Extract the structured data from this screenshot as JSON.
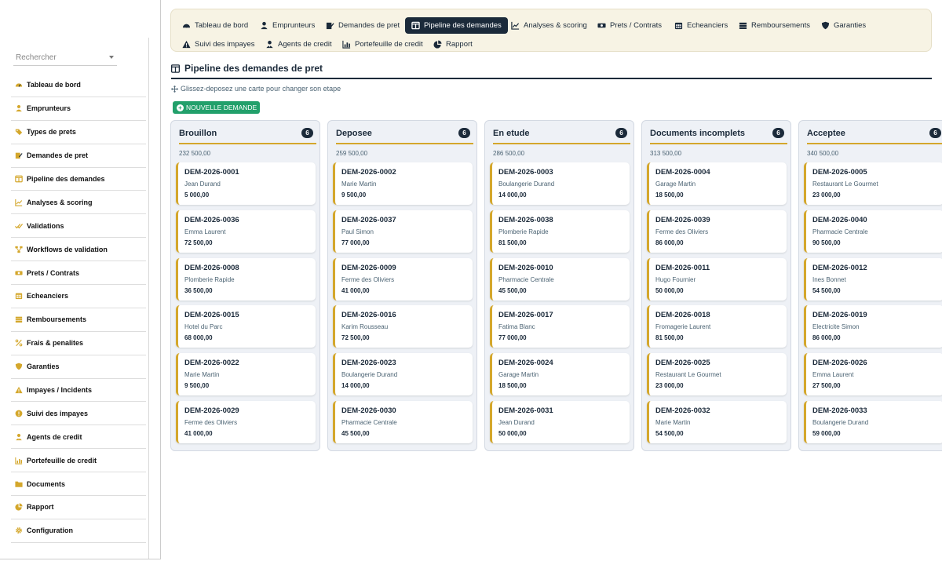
{
  "sidebar": {
    "select_placeholder": "Rechercher",
    "items": [
      {
        "label": "Tableau de bord",
        "icon": "gauge-icon"
      },
      {
        "label": "Emprunteurs",
        "icon": "user-icon"
      },
      {
        "label": "Types de prets",
        "icon": "tags-icon"
      },
      {
        "label": "Demandes de pret",
        "icon": "edit-document-icon"
      },
      {
        "label": "Pipeline des demandes",
        "icon": "columns-icon"
      },
      {
        "label": "Analyses & scoring",
        "icon": "line-chart-icon"
      },
      {
        "label": "Validations",
        "icon": "double-check-icon"
      },
      {
        "label": "Workflows de validation",
        "icon": "workflow-icon"
      },
      {
        "label": "Prets / Contrats",
        "icon": "money-icon"
      },
      {
        "label": "Echeanciers",
        "icon": "calendar-icon"
      },
      {
        "label": "Remboursements",
        "icon": "money-stack-icon"
      },
      {
        "label": "Frais & penalites",
        "icon": "percent-icon"
      },
      {
        "label": "Garanties",
        "icon": "shield-icon"
      },
      {
        "label": "Impayes / Incidents",
        "icon": "warning-icon"
      },
      {
        "label": "Suivi des impayes",
        "icon": "exclamation-circle-icon"
      },
      {
        "label": "Agents de credit",
        "icon": "user-tie-icon"
      },
      {
        "label": "Portefeuille de credit",
        "icon": "bar-chart-icon"
      },
      {
        "label": "Documents",
        "icon": "folder-icon"
      },
      {
        "label": "Rapport",
        "icon": "pie-chart-icon"
      },
      {
        "label": "Configuration",
        "icon": "gear-icon"
      }
    ]
  },
  "topnav": {
    "tabs": [
      {
        "label": "Tableau de bord",
        "icon": "gauge-icon",
        "active": false
      },
      {
        "label": "Emprunteurs",
        "icon": "user-icon",
        "active": false
      },
      {
        "label": "Demandes de pret",
        "icon": "edit-document-icon",
        "active": false
      },
      {
        "label": "Pipeline des demandes",
        "icon": "columns-icon",
        "active": true
      },
      {
        "label": "Analyses & scoring",
        "icon": "line-chart-icon",
        "active": false
      },
      {
        "label": "Prets / Contrats",
        "icon": "money-icon",
        "active": false
      },
      {
        "label": "Echeanciers",
        "icon": "calendar-icon",
        "active": false
      },
      {
        "label": "Remboursements",
        "icon": "money-stack-icon",
        "active": false
      },
      {
        "label": "Garanties",
        "icon": "shield-icon",
        "active": false
      },
      {
        "label": "Suivi des impayes",
        "icon": "warning-icon",
        "active": false
      },
      {
        "label": "Agents de credit",
        "icon": "user-tie-icon",
        "active": false
      },
      {
        "label": "Portefeuille de credit",
        "icon": "bar-chart-icon",
        "active": false
      },
      {
        "label": "Rapport",
        "icon": "pie-chart-icon",
        "active": false
      }
    ]
  },
  "page": {
    "title": "Pipeline des demandes de pret",
    "hint": "Glissez-deposez une carte pour changer son etape",
    "new_button": "NOUVELLE DEMANDE"
  },
  "colors": {
    "navy": "#1b2a3a",
    "gold": "#d4a72c",
    "green": "#22a06b",
    "nav_bg": "#f7f3e4",
    "column_bg": "#eef1f6"
  },
  "columns": [
    {
      "title": "Brouillon",
      "count": "6",
      "total": "232 500,00",
      "cards": [
        {
          "ref": "DEM-2026-0001",
          "client": "Jean Durand",
          "amount": "5 000,00"
        },
        {
          "ref": "DEM-2026-0036",
          "client": "Emma Laurent",
          "amount": "72 500,00"
        },
        {
          "ref": "DEM-2026-0008",
          "client": "Plomberie Rapide",
          "amount": "36 500,00"
        },
        {
          "ref": "DEM-2026-0015",
          "client": "Hotel du Parc",
          "amount": "68 000,00"
        },
        {
          "ref": "DEM-2026-0022",
          "client": "Marie Martin",
          "amount": "9 500,00"
        },
        {
          "ref": "DEM-2026-0029",
          "client": "Ferme des Oliviers",
          "amount": "41 000,00"
        }
      ]
    },
    {
      "title": "Deposee",
      "count": "6",
      "total": "259 500,00",
      "cards": [
        {
          "ref": "DEM-2026-0002",
          "client": "Marie Martin",
          "amount": "9 500,00"
        },
        {
          "ref": "DEM-2026-0037",
          "client": "Paul Simon",
          "amount": "77 000,00"
        },
        {
          "ref": "DEM-2026-0009",
          "client": "Ferme des Oliviers",
          "amount": "41 000,00"
        },
        {
          "ref": "DEM-2026-0016",
          "client": "Karim Rousseau",
          "amount": "72 500,00"
        },
        {
          "ref": "DEM-2026-0023",
          "client": "Boulangerie Durand",
          "amount": "14 000,00"
        },
        {
          "ref": "DEM-2026-0030",
          "client": "Pharmacie Centrale",
          "amount": "45 500,00"
        }
      ]
    },
    {
      "title": "En etude",
      "count": "6",
      "total": "286 500,00",
      "cards": [
        {
          "ref": "DEM-2026-0003",
          "client": "Boulangerie Durand",
          "amount": "14 000,00"
        },
        {
          "ref": "DEM-2026-0038",
          "client": "Plomberie Rapide",
          "amount": "81 500,00"
        },
        {
          "ref": "DEM-2026-0010",
          "client": "Pharmacie Centrale",
          "amount": "45 500,00"
        },
        {
          "ref": "DEM-2026-0017",
          "client": "Fatima Blanc",
          "amount": "77 000,00"
        },
        {
          "ref": "DEM-2026-0024",
          "client": "Garage Martin",
          "amount": "18 500,00"
        },
        {
          "ref": "DEM-2026-0031",
          "client": "Jean Durand",
          "amount": "50 000,00"
        }
      ]
    },
    {
      "title": "Documents incomplets",
      "count": "6",
      "total": "313 500,00",
      "cards": [
        {
          "ref": "DEM-2026-0004",
          "client": "Garage Martin",
          "amount": "18 500,00"
        },
        {
          "ref": "DEM-2026-0039",
          "client": "Ferme des Oliviers",
          "amount": "86 000,00"
        },
        {
          "ref": "DEM-2026-0011",
          "client": "Hugo Fournier",
          "amount": "50 000,00"
        },
        {
          "ref": "DEM-2026-0018",
          "client": "Fromagerie Laurent",
          "amount": "81 500,00"
        },
        {
          "ref": "DEM-2026-0025",
          "client": "Restaurant Le Gourmet",
          "amount": "23 000,00"
        },
        {
          "ref": "DEM-2026-0032",
          "client": "Marie Martin",
          "amount": "54 500,00"
        }
      ]
    },
    {
      "title": "Acceptee",
      "count": "6",
      "total": "340 500,00",
      "cards": [
        {
          "ref": "DEM-2026-0005",
          "client": "Restaurant Le Gourmet",
          "amount": "23 000,00"
        },
        {
          "ref": "DEM-2026-0040",
          "client": "Pharmacie Centrale",
          "amount": "90 500,00"
        },
        {
          "ref": "DEM-2026-0012",
          "client": "Ines Bonnet",
          "amount": "54 500,00"
        },
        {
          "ref": "DEM-2026-0019",
          "client": "Electricite Simon",
          "amount": "86 000,00"
        },
        {
          "ref": "DEM-2026-0026",
          "client": "Emma Laurent",
          "amount": "27 500,00"
        },
        {
          "ref": "DEM-2026-0033",
          "client": "Boulangerie Durand",
          "amount": "59 000,00"
        }
      ]
    }
  ]
}
